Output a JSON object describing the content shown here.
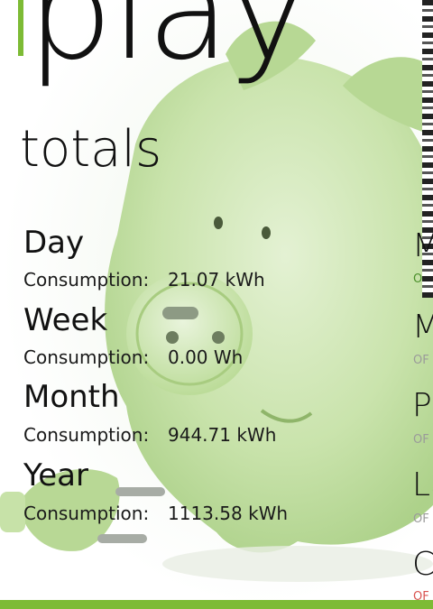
{
  "app": {
    "title": "play"
  },
  "section": {
    "title": "totals"
  },
  "stats": [
    {
      "period": "Day",
      "key": "Consumption:",
      "value": "21.07 kWh"
    },
    {
      "period": "Week",
      "key": "Consumption:",
      "value": "0.00 Wh"
    },
    {
      "period": "Month",
      "key": "Consumption:",
      "value": "944.71 kWh"
    },
    {
      "period": "Year",
      "key": "Consumption:",
      "value": "1113.58 kWh"
    }
  ],
  "next_page": {
    "items": [
      {
        "letter": "M",
        "sub": "O"
      },
      {
        "letter": "M",
        "sub": "OF"
      },
      {
        "letter": "P",
        "sub": "OF"
      },
      {
        "letter": "La",
        "sub": "OF"
      },
      {
        "letter": "C",
        "sub": "OF"
      }
    ]
  },
  "colors": {
    "accent": "#7dbb35",
    "pig": "#c5e0a6",
    "status_off": "#d9534f"
  },
  "illustration": {
    "subject": "green piggy bank with electrical plug snout"
  }
}
